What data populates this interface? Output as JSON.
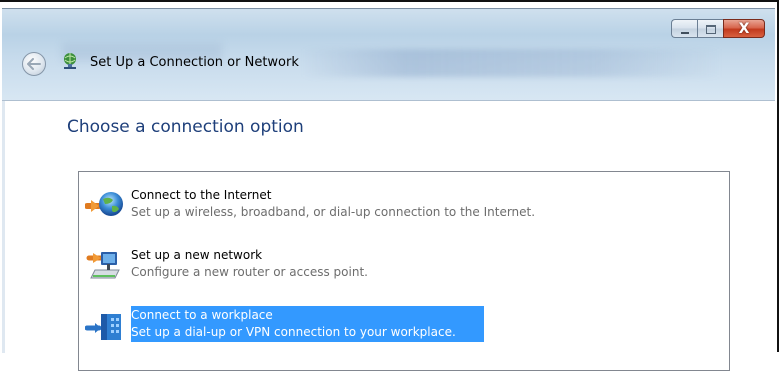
{
  "window": {
    "title": "Set Up a Connection or Network",
    "controls": {
      "minimize": "minimize",
      "maximize": "maximize",
      "close": "X"
    }
  },
  "page": {
    "heading": "Choose a connection option"
  },
  "options": [
    {
      "title": "Connect to the Internet",
      "description": "Set up a wireless, broadband, or dial-up connection to the Internet.",
      "icon": "globe-internet-icon",
      "selected": false
    },
    {
      "title": "Set up a new network",
      "description": "Configure a new router or access point.",
      "icon": "router-network-icon",
      "selected": false
    },
    {
      "title": "Connect to a workplace",
      "description": "Set up a dial-up or VPN connection to your workplace.",
      "icon": "workplace-building-icon",
      "selected": true
    }
  ],
  "colors": {
    "heading": "#1e3f7a",
    "selection": "#3399ff",
    "description": "#6d6d6d"
  }
}
